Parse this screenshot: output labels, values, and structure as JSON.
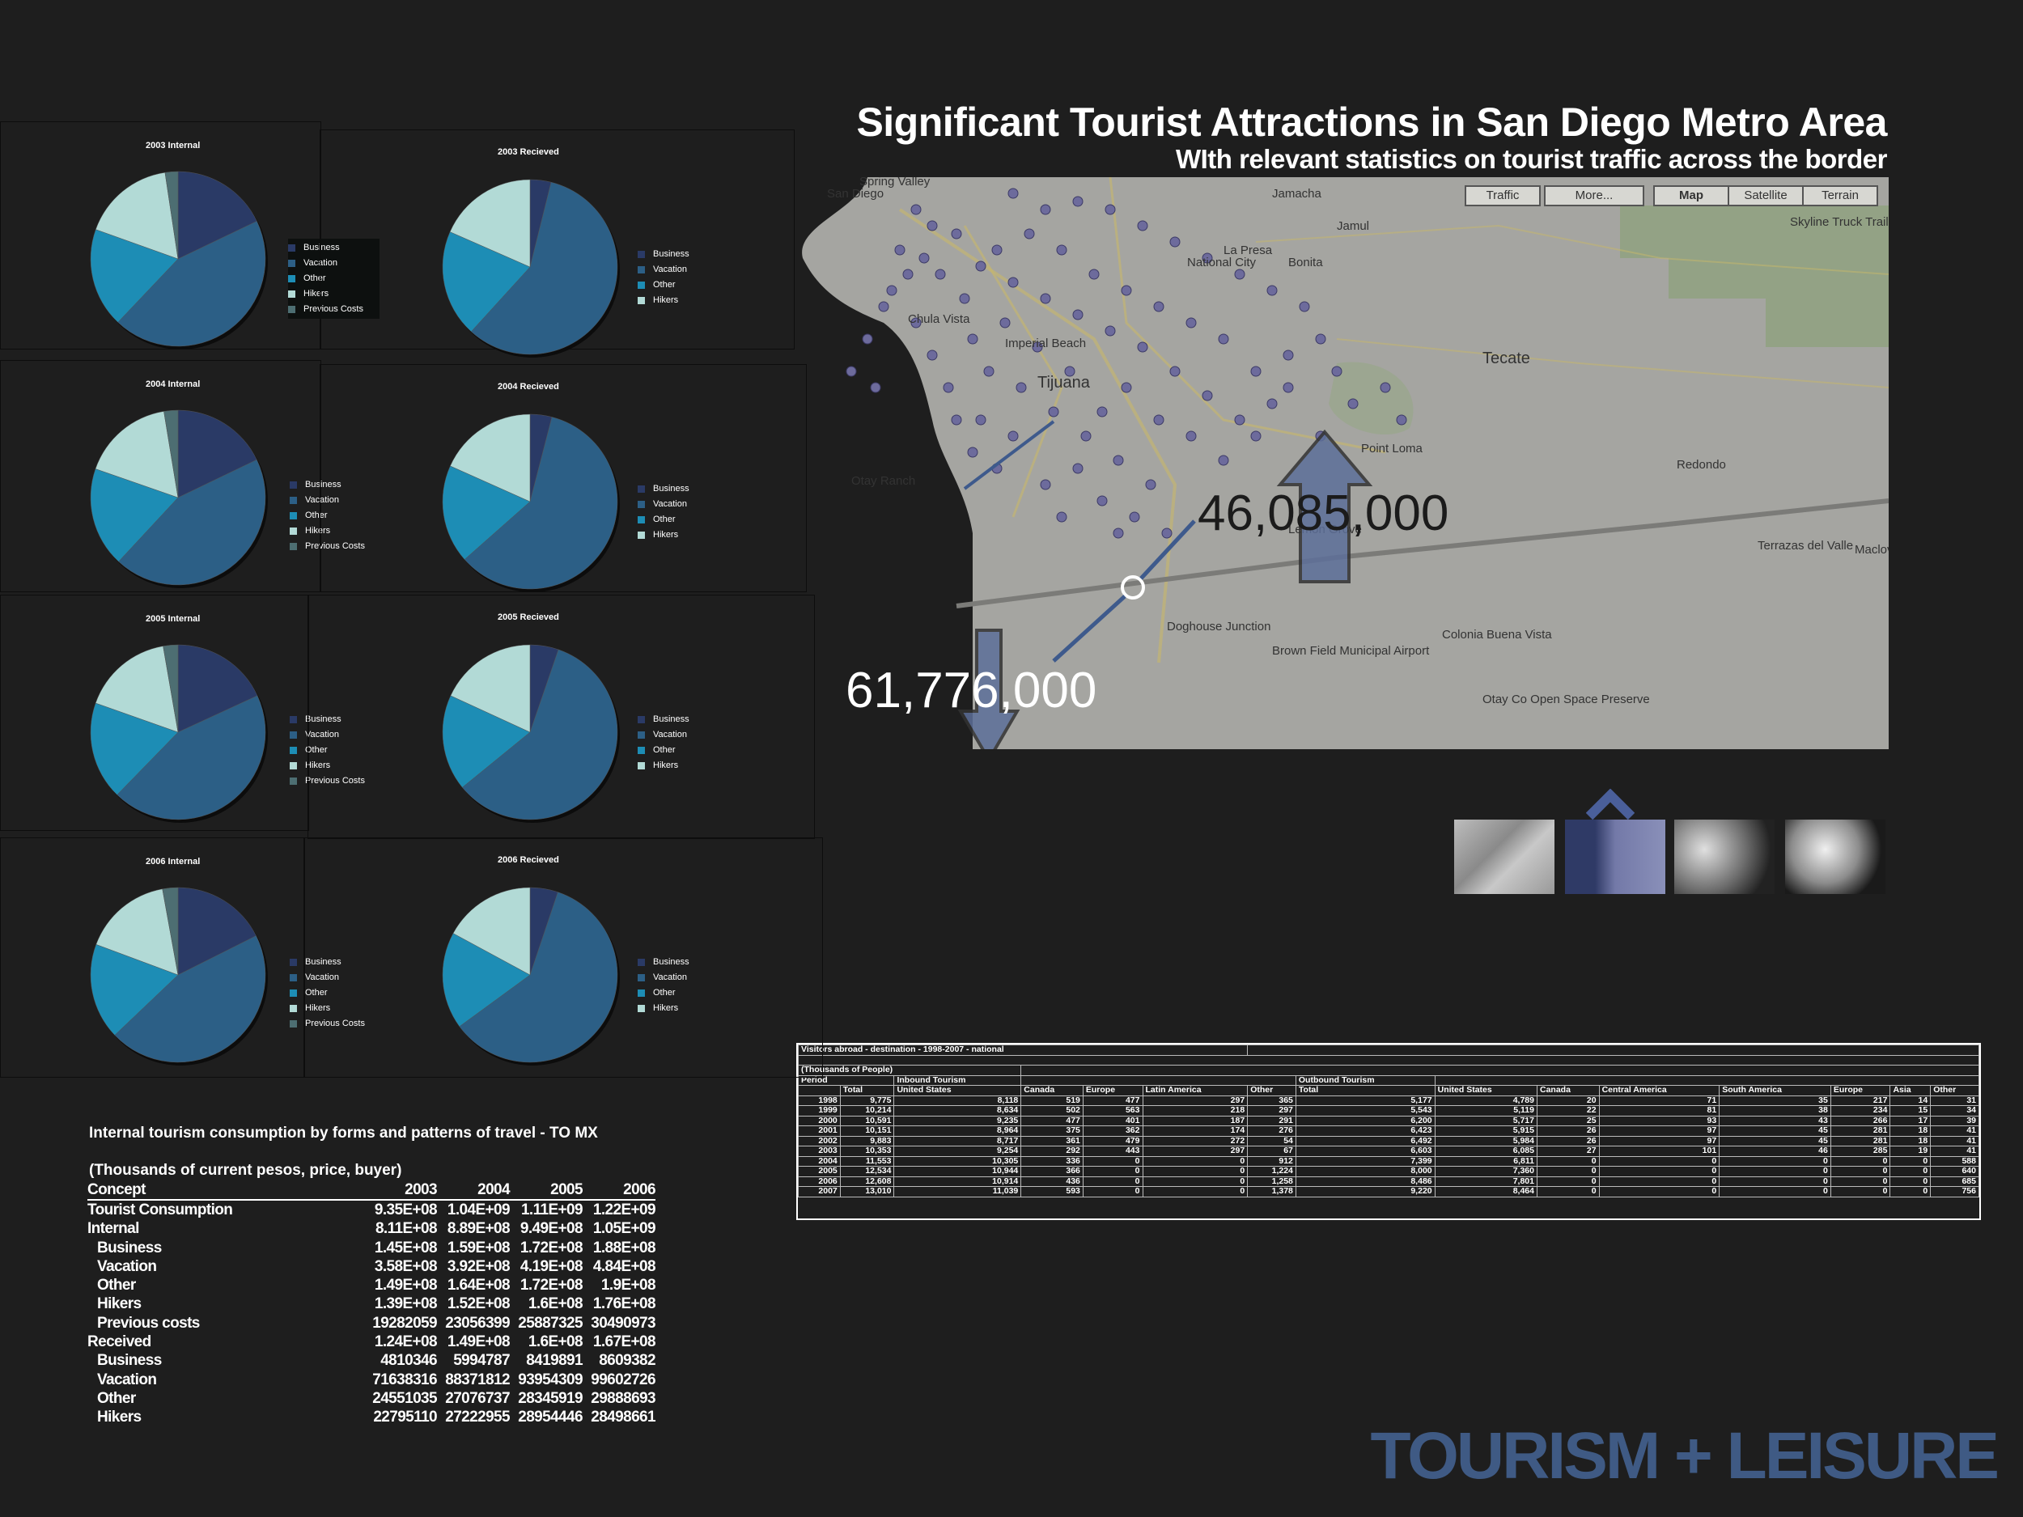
{
  "header": {
    "title": "Significant Tourist Attractions in San Diego Metro Area",
    "subtitle": "WIth relevant statistics on tourist traffic across the border"
  },
  "colors": {
    "business": "#2a3a66",
    "vacation": "#2c5f86",
    "other": "#1d8db5",
    "hikers": "#b2dad6",
    "previous_costs": "#4d6e72",
    "brand": "#3f5a84"
  },
  "pies": [
    {
      "title": "2003 Internal",
      "legend": [
        "Business",
        "Vacation",
        "Other",
        "Hikers",
        "Previous Costs"
      ],
      "values": [
        145000000.0,
        358000000.0,
        149000000.0,
        139000000.0,
        19282059
      ]
    },
    {
      "title": "2003 Recieved",
      "legend": [
        "Business",
        "Vacation",
        "Other",
        "Hikers"
      ],
      "values": [
        4810346,
        71638316,
        24551035,
        22795110
      ]
    },
    {
      "title": "2004 Internal",
      "legend": [
        "Business",
        "Vacation",
        "Other",
        "Hikers",
        "Previous Costs"
      ],
      "values": [
        159000000.0,
        392000000.0,
        164000000.0,
        152000000.0,
        23056399
      ]
    },
    {
      "title": "2004 Recieved",
      "legend": [
        "Business",
        "Vacation",
        "Other",
        "Hikers"
      ],
      "values": [
        5994787,
        88371812,
        27076737,
        27222955
      ]
    },
    {
      "title": "2005 Internal",
      "legend": [
        "Business",
        "Vacation",
        "Other",
        "Hikers",
        "Previous Costs"
      ],
      "values": [
        172000000.0,
        419000000.0,
        172000000.0,
        160000000.0,
        25887325
      ]
    },
    {
      "title": "2005 Recieved",
      "legend": [
        "Business",
        "Vacation",
        "Other",
        "Hikers"
      ],
      "values": [
        8419891,
        93954309,
        28345919,
        28954446
      ]
    },
    {
      "title": "2006 Internal",
      "legend": [
        "Business",
        "Vacation",
        "Other",
        "Hikers",
        "Previous Costs"
      ],
      "values": [
        188000000.0,
        484000000.0,
        190000000.0,
        176000000.0,
        30490973
      ]
    },
    {
      "title": "2006 Recieved",
      "legend": [
        "Business",
        "Vacation",
        "Other",
        "Hikers"
      ],
      "values": [
        8609382,
        99602726,
        29888693,
        28498661
      ]
    }
  ],
  "map": {
    "buttons": [
      "Traffic",
      "More...",
      "Map",
      "Satellite",
      "Terrain"
    ],
    "inbound_value": "46,085,000",
    "outbound_value": "61,776,000",
    "labels": [
      "San Diego",
      "Jamacha",
      "Jamul",
      "La Presa",
      "National City",
      "Bonita",
      "Chula Vista",
      "Imperial Beach",
      "Tijuana",
      "Otay Ranch",
      "Doghouse Junction",
      "Tecate",
      "Redondo",
      "Terrazas del Valle",
      "Maclovio Rojas",
      "Colonia Buena Vista",
      "Otay Co Open Space Preserve",
      "Brown Field Municipal Airport",
      "Point Loma",
      "Lemon Grove",
      "Spring Valley",
      "Skyline Truck Trail"
    ]
  },
  "thumbnails": [
    "street-view-thumb",
    "map-thumb",
    "terrain-thumb",
    "satellite-thumb"
  ],
  "consumption_table": {
    "title": "Internal tourism consumption by forms and patterns of travel - TO MX",
    "subtitle": "(Thousands of current pesos, price, buyer)",
    "columns": [
      "Concept",
      "2003",
      "2004",
      "2005",
      "2006"
    ],
    "rows": [
      [
        "Tourist Consumption",
        "9.35E+08",
        "1.04E+09",
        "1.11E+09",
        "1.22E+09"
      ],
      [
        "Internal",
        "8.11E+08",
        "8.89E+08",
        "9.49E+08",
        "1.05E+09"
      ],
      [
        "  Business",
        "1.45E+08",
        "1.59E+08",
        "1.72E+08",
        "1.88E+08"
      ],
      [
        "  Vacation",
        "3.58E+08",
        "3.92E+08",
        "4.19E+08",
        "4.84E+08"
      ],
      [
        "  Other",
        "1.49E+08",
        "1.64E+08",
        "1.72E+08",
        "1.9E+08"
      ],
      [
        "  Hikers",
        "1.39E+08",
        "1.52E+08",
        "1.6E+08",
        "1.76E+08"
      ],
      [
        "  Previous costs",
        "19282059",
        "23056399",
        "25887325",
        "30490973"
      ],
      [
        "Received",
        "1.24E+08",
        "1.49E+08",
        "1.6E+08",
        "1.67E+08"
      ],
      [
        "  Business",
        "4810346",
        "5994787",
        "8419891",
        "8609382"
      ],
      [
        "  Vacation",
        "71638316",
        "88371812",
        "93954309",
        "99602726"
      ],
      [
        "  Other",
        "24551035",
        "27076737",
        "28345919",
        "29888693"
      ],
      [
        "  Hikers",
        "22795110",
        "27222955",
        "28954446",
        "28498661"
      ]
    ]
  },
  "visitors_table": {
    "title": "Visitors abroad - destination - 1998-2007 - national",
    "units": "(Thousands of People)",
    "period_label": "Period",
    "inbound_label": "Inbound Tourism",
    "outbound_label": "Outbound Tourism",
    "columns": [
      "Total",
      "United States",
      "Canada",
      "Europe",
      "Latin America",
      "Other",
      "Total",
      "United States",
      "Canada",
      "Central America",
      "South America",
      "Europe",
      "Asia",
      "Other"
    ],
    "rows": [
      [
        "1998",
        "9,775",
        "8,118",
        "519",
        "477",
        "297",
        "365",
        "5,177",
        "4,789",
        "20",
        "71",
        "35",
        "217",
        "14",
        "31"
      ],
      [
        "1999",
        "10,214",
        "8,634",
        "502",
        "563",
        "218",
        "297",
        "5,543",
        "5,119",
        "22",
        "81",
        "38",
        "234",
        "15",
        "34"
      ],
      [
        "2000",
        "10,591",
        "9,235",
        "477",
        "401",
        "187",
        "291",
        "6,200",
        "5,717",
        "25",
        "93",
        "43",
        "266",
        "17",
        "39"
      ],
      [
        "2001",
        "10,151",
        "8,964",
        "375",
        "362",
        "174",
        "276",
        "6,423",
        "5,915",
        "26",
        "97",
        "45",
        "281",
        "18",
        "41"
      ],
      [
        "2002",
        "9,883",
        "8,717",
        "361",
        "479",
        "272",
        "54",
        "6,492",
        "5,984",
        "26",
        "97",
        "45",
        "281",
        "18",
        "41"
      ],
      [
        "2003",
        "10,353",
        "9,254",
        "292",
        "443",
        "297",
        "67",
        "6,603",
        "6,085",
        "27",
        "101",
        "46",
        "285",
        "19",
        "41"
      ],
      [
        "2004",
        "11,553",
        "10,305",
        "336",
        "0",
        "0",
        "912",
        "7,399",
        "6,811",
        "0",
        "0",
        "0",
        "0",
        "0",
        "588"
      ],
      [
        "2005",
        "12,534",
        "10,944",
        "366",
        "0",
        "0",
        "1,224",
        "8,000",
        "7,360",
        "0",
        "0",
        "0",
        "0",
        "0",
        "640"
      ],
      [
        "2006",
        "12,608",
        "10,914",
        "436",
        "0",
        "0",
        "1,258",
        "8,486",
        "7,801",
        "0",
        "0",
        "0",
        "0",
        "0",
        "685"
      ],
      [
        "2007",
        "13,010",
        "11,039",
        "593",
        "0",
        "0",
        "1,378",
        "9,220",
        "8,464",
        "0",
        "0",
        "0",
        "0",
        "0",
        "756"
      ]
    ]
  },
  "brand": {
    "text": "TOURISM + LEISURE"
  }
}
